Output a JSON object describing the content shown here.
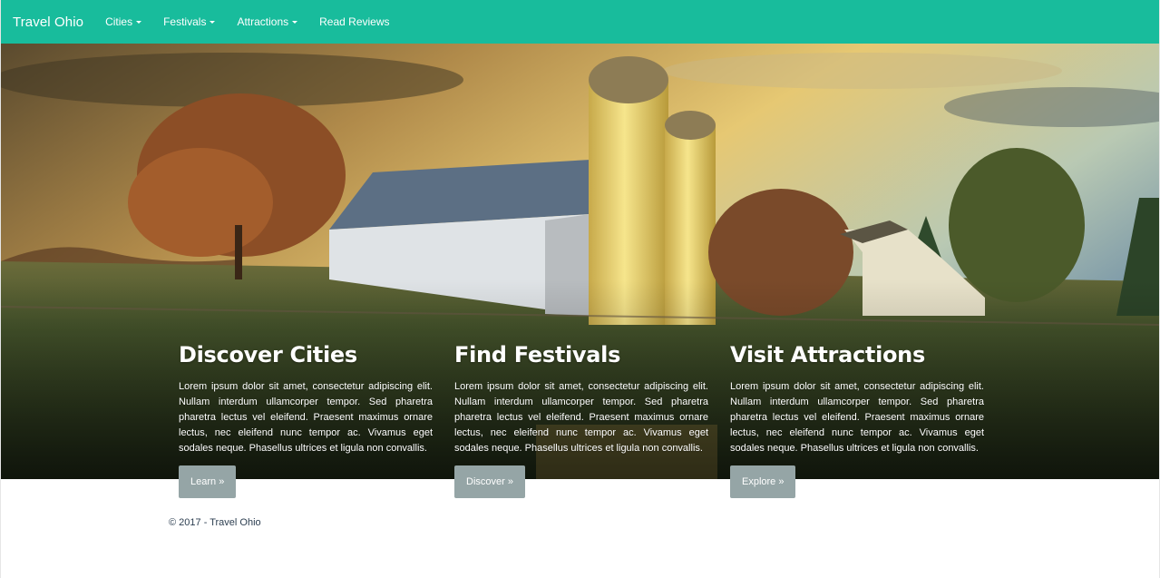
{
  "navbar": {
    "brand": "Travel Ohio",
    "items": [
      {
        "label": "Cities",
        "dropdown": true
      },
      {
        "label": "Festivals",
        "dropdown": true
      },
      {
        "label": "Attractions",
        "dropdown": true
      },
      {
        "label": "Read Reviews",
        "dropdown": false
      }
    ]
  },
  "hero": {
    "image_description": "farm with white barn and two silos at sunset"
  },
  "columns": [
    {
      "title": "Discover Cities",
      "text": "Lorem ipsum dolor sit amet, consectetur adipiscing elit. Nullam interdum ullamcorper tempor. Sed pharetra pharetra lectus vel eleifend. Praesent maximus ornare lectus, nec eleifend nunc tempor ac. Vivamus eget sodales neque. Phasellus ultrices et ligula non convallis.",
      "button": "Learn »"
    },
    {
      "title": "Find Festivals",
      "text": "Lorem ipsum dolor sit amet, consectetur adipiscing elit. Nullam interdum ullamcorper tempor. Sed pharetra pharetra lectus vel eleifend. Praesent maximus ornare lectus, nec eleifend nunc tempor ac. Vivamus eget sodales neque. Phasellus ultrices et ligula non convallis.",
      "button": "Discover »"
    },
    {
      "title": "Visit Attractions",
      "text": "Lorem ipsum dolor sit amet, consectetur adipiscing elit. Nullam interdum ullamcorper tempor. Sed pharetra pharetra lectus vel eleifend. Praesent maximus ornare lectus, nec eleifend nunc tempor ac. Vivamus eget sodales neque. Phasellus ultrices et ligula non convallis.",
      "button": "Explore »"
    }
  ],
  "footer": {
    "text": "© 2017 - Travel Ohio"
  },
  "colors": {
    "navbar": "#18bc9c",
    "button": "#95a5a6",
    "footer_text": "#2c3e50"
  }
}
